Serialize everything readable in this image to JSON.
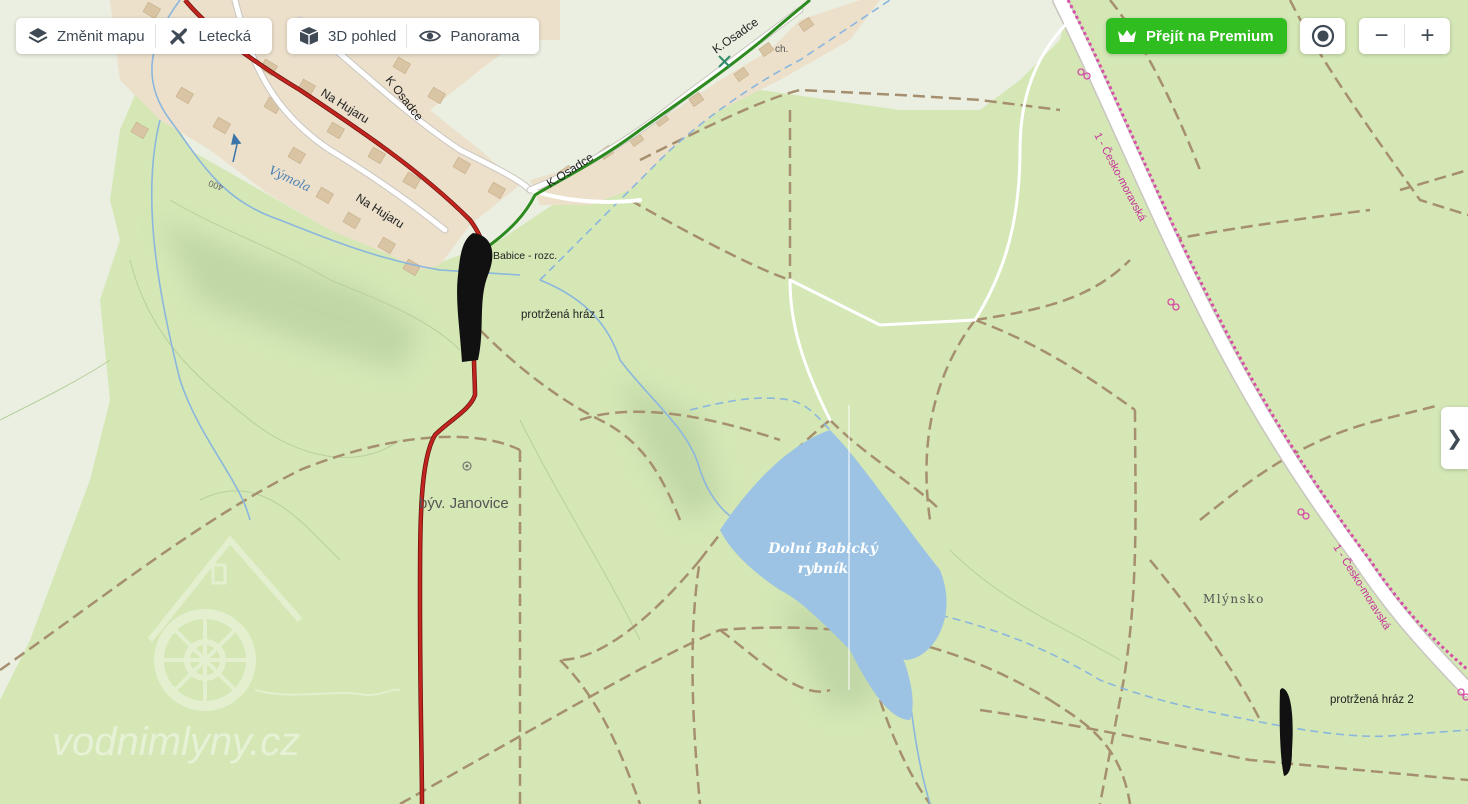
{
  "toolbar": {
    "change_map": "Změnit mapu",
    "aerial": "Letecká",
    "view3d": "3D pohled",
    "panorama": "Panorama"
  },
  "premium": {
    "label": "Přejít na Premium"
  },
  "zoom": {
    "out": "−",
    "in": "+"
  },
  "expand": {
    "label": "❯"
  },
  "map": {
    "streets": {
      "na_hujaru_1": "Na Hujaru",
      "na_hujaru_2": "Na Hujaru",
      "k_osadce_1": "K Osadce",
      "k_osadce_2": "K.Osadce",
      "k_osadce_3": "K.Osadce"
    },
    "ch": "ch.",
    "stream": "Výmola",
    "contour": "400",
    "bus_stop": "Babice - rozc.",
    "dam1": "protržená hráz 1",
    "dam2": "protržená hráz 2",
    "village": "býv. Janovice",
    "pond_line1": "Dolní Babický",
    "pond_line2": "rybník",
    "locality": "Mlýnsko",
    "cycle_route_1": "1 - Česko-moravská",
    "cycle_route_2": "1 - Česko-moravská",
    "watermark": "vodnimlyny.cz"
  },
  "colors": {
    "forest": "#d4e7b5",
    "meadow": "#eaefe1",
    "settlement": "#ece0cb",
    "water": "#9cc3e3",
    "premium": "#2fbd1f",
    "red_trail": "#c2251f",
    "green_trail": "#2c8a1f",
    "cycle_route": "#d64ea5"
  }
}
